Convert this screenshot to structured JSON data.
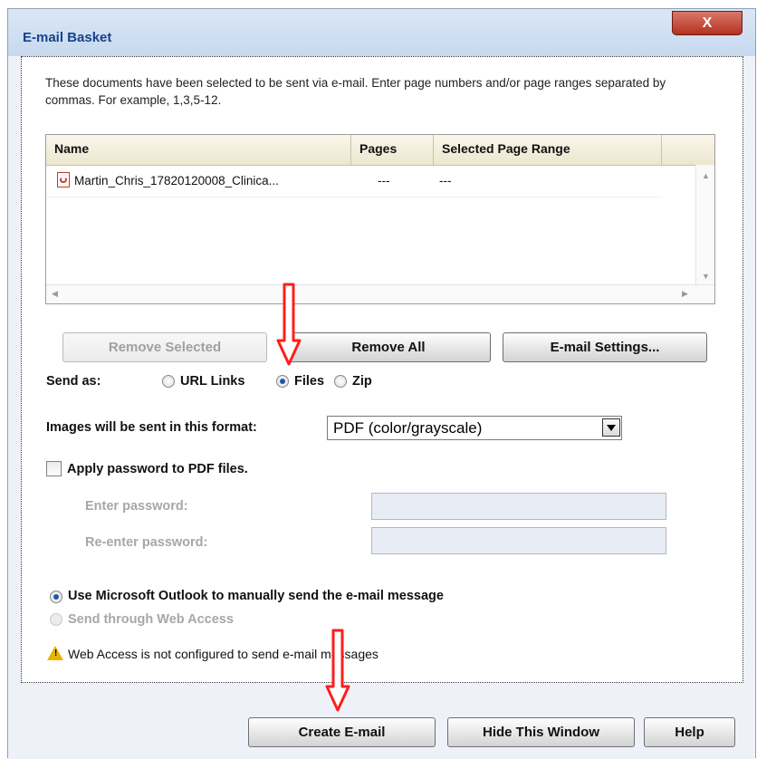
{
  "window": {
    "title": "E-mail Basket",
    "close_label": "X"
  },
  "intro": "These documents have been selected to be sent via e-mail. Enter page numbers and/or page ranges separated by commas. For example, 1,3,5-12.",
  "table": {
    "columns": [
      "Name",
      "Pages",
      "Selected Page Range"
    ],
    "rows": [
      {
        "name": "Martin_Chris_17820120008_Clinica...",
        "pages": "---",
        "range": "---"
      }
    ]
  },
  "buttons": {
    "remove_selected": "Remove Selected",
    "remove_all": "Remove All",
    "email_settings": "E-mail Settings..."
  },
  "send_as": {
    "label": "Send as:",
    "options": [
      "URL Links",
      "Files",
      "Zip"
    ],
    "selected": "Files"
  },
  "format": {
    "label": "Images will be sent in this format:",
    "value": "PDF (color/grayscale)"
  },
  "password": {
    "apply_label": "Apply password to PDF files.",
    "enter_label": "Enter password:",
    "reenter_label": "Re-enter password:",
    "enter_value": "",
    "reenter_value": ""
  },
  "send_method": {
    "outlook_label": "Use Microsoft Outlook to manually send the e-mail message",
    "web_label": "Send through Web Access",
    "selected": "outlook"
  },
  "warning": "Web Access is not configured to send e-mail messages",
  "footer": {
    "create": "Create E-mail",
    "hide": "Hide This Window",
    "help": "Help"
  },
  "colors": {
    "title_text": "#15428b",
    "close_red": "#b3311f",
    "annotation_red": "#ff1e1e"
  },
  "icons": [
    "close-icon",
    "pdf-file-icon",
    "warning-icon",
    "dropdown-arrow-icon",
    "red-arrow-annotation"
  ]
}
